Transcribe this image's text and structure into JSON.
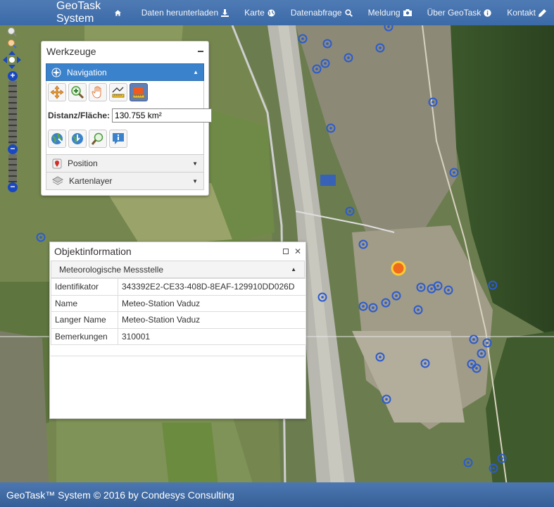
{
  "navbar": {
    "brand": "GeoTask System",
    "items": [
      {
        "label": "Daten herunterladen",
        "icon": "download-icon"
      },
      {
        "label": "Karte",
        "icon": "globe-icon"
      },
      {
        "label": "Datenabfrage",
        "icon": "search-icon"
      },
      {
        "label": "Meldung",
        "icon": "camera-icon"
      },
      {
        "label": "Über GeoTask",
        "icon": "info-icon"
      },
      {
        "label": "Kontakt",
        "icon": "pencil-icon"
      }
    ]
  },
  "tools_panel": {
    "title": "Werkzeuge",
    "navigation_label": "Navigation",
    "distance_label": "Distanz/Fläche:",
    "distance_value": "130.755 km²",
    "position_label": "Position",
    "layers_label": "Kartenlayer"
  },
  "object_info": {
    "title": "Objektinformation",
    "group": "Meteorologische Messstelle",
    "rows": [
      {
        "key": "Identifikator",
        "value": "343392E2-CE33-408D-8EAF-129910DD026D"
      },
      {
        "key": "Name",
        "value": "Meteo-Station Vaduz"
      },
      {
        "key": "Langer Name",
        "value": "Meteo-Station Vaduz"
      },
      {
        "key": "Bemerkungen",
        "value": "310001"
      }
    ]
  },
  "footer": {
    "text": "GeoTask™ System © 2016 by Condesys Consulting"
  },
  "colors": {
    "navbar": "#3f6eab",
    "accent": "#3b82cc",
    "marker": "#2c5bd0"
  }
}
